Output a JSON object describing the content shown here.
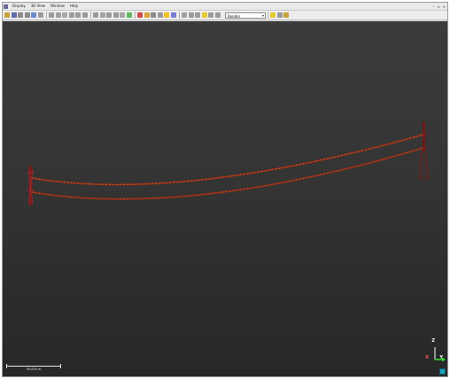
{
  "menu": {
    "items": [
      "Display",
      "3D View",
      "Window",
      "Help"
    ]
  },
  "toolbar": {
    "view_mode_value": "Render",
    "buttons": [
      {
        "name": "open-file-icon",
        "color": "#c9a23a"
      },
      {
        "name": "save-icon",
        "color": "#5a6fa8"
      },
      {
        "name": "undo-icon",
        "color": "#8a8a8a"
      },
      {
        "name": "redo-icon",
        "color": "#8a8a8a"
      },
      {
        "name": "select-icon",
        "color": "#6a8ad0"
      },
      {
        "name": "lasso-icon",
        "color": "#9a9a9a"
      },
      {
        "name": "pan-icon",
        "color": "#9a9a9a"
      },
      {
        "name": "zoom-icon",
        "color": "#a0a0a0"
      },
      {
        "name": "fit-view-icon",
        "color": "#a8a8a8"
      },
      {
        "name": "top-view-icon",
        "color": "#9a9a9a"
      },
      {
        "name": "front-view-icon",
        "color": "#9a9a9a"
      },
      {
        "name": "side-view-icon",
        "color": "#9a9a9a"
      },
      {
        "name": "iso-view-icon",
        "color": "#9a9a9a"
      },
      {
        "name": "grid-icon",
        "color": "#a4a4a4"
      },
      {
        "name": "measure-icon",
        "color": "#9a9a9a"
      },
      {
        "name": "section-icon",
        "color": "#9a9a9a"
      },
      {
        "name": "layers-icon",
        "color": "#a4a4a4"
      },
      {
        "name": "color-ramp-icon",
        "color": "#5fb85f"
      },
      {
        "name": "rgb-icon",
        "color": "#d04a4a"
      },
      {
        "name": "classify-icon",
        "color": "#d8a23a"
      },
      {
        "name": "filter-icon",
        "color": "#8a8a8a"
      },
      {
        "name": "point-size-icon",
        "color": "#9a9a9a"
      },
      {
        "name": "light-icon",
        "color": "#f0c020"
      },
      {
        "name": "profile-icon",
        "color": "#7a7ad0"
      },
      {
        "name": "sphere-icon",
        "color": "#a0a0a0"
      },
      {
        "name": "ortho-icon",
        "color": "#9a9a9a"
      },
      {
        "name": "perspective-icon",
        "color": "#9a9a9a"
      },
      {
        "name": "highlight-icon",
        "color": "#e6c82a"
      },
      {
        "name": "snapshot-icon",
        "color": "#9a9a9a"
      },
      {
        "name": "settings-icon",
        "color": "#9a9a9a"
      }
    ]
  },
  "scene": {
    "scale_label": "50.000 m",
    "axis_labels": {
      "z": "Z",
      "y": "Y",
      "x": "X"
    },
    "colors": {
      "conductor": "#8f2a1a",
      "conductor_highlight": "#c9a040",
      "tower_left": "#7a1c1c",
      "tower_right": "#6e1818"
    }
  }
}
